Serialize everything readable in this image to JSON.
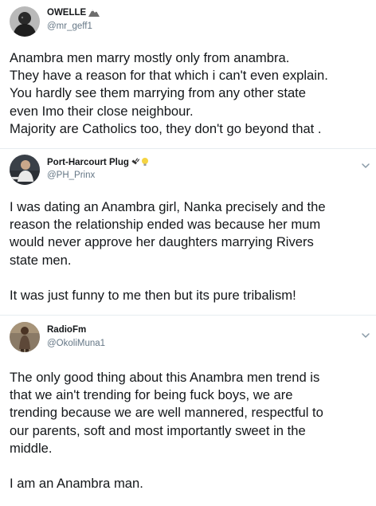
{
  "tweets": [
    {
      "name": "OWELLE",
      "name_emoji_icon": "mountain-emoji-icon",
      "handle": "@mr_geff1",
      "lines": [
        "Anambra men marry mostly only from anambra.",
        "They have a reason for that which i can't even explain.",
        "You hardly see them marrying from any other state",
        "even Imo their close neighbour.",
        "Majority are Catholics too, they don't go beyond that ."
      ]
    },
    {
      "name": "Port-Harcourt Plug",
      "name_emoji_icon": "plug-and-bulb-emoji-icon",
      "handle": "@PH_Prinx",
      "lines": [
        "I was dating an Anambra girl, Nanka precisely and the",
        "reason the relationship ended was because her mum",
        "would never approve her daughters marrying Rivers",
        "state men."
      ],
      "lines2": [
        "It was just funny to me then but its pure tribalism!"
      ]
    },
    {
      "name": "RadioFm",
      "handle": "@OkoliMuna1",
      "lines": [
        "The only good thing about this Anambra men trend is",
        "that we ain't trending for being fuck boys, we are",
        "trending because we are well mannered, respectful to",
        "our parents, soft and most importantly sweet in the",
        "middle."
      ],
      "lines2": [
        "I am an Anambra man."
      ]
    }
  ]
}
